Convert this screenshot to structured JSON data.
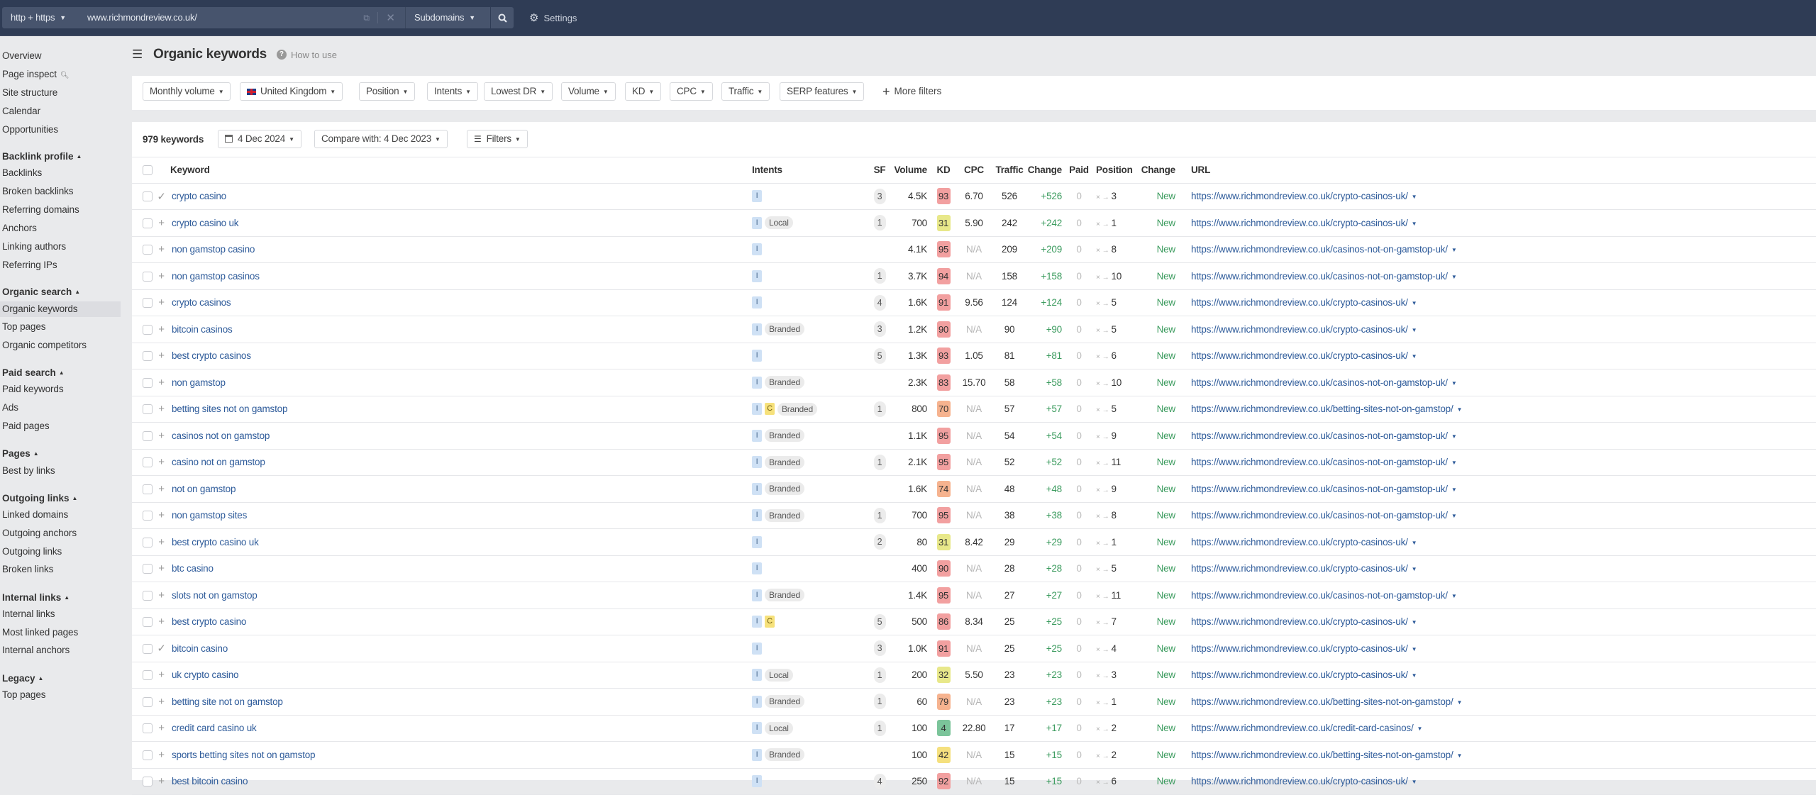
{
  "topbar": {
    "protocol": "http + https",
    "url": "www.richmondreview.co.uk/",
    "mode": "Subdomains",
    "settings": "Settings"
  },
  "sidebar": {
    "top_items": [
      "Overview",
      "Page inspect",
      "Site structure",
      "Calendar",
      "Opportunities"
    ],
    "sections": [
      {
        "title": "Backlink profile",
        "items": [
          "Backlinks",
          "Broken backlinks",
          "Referring domains",
          "Anchors",
          "Linking authors",
          "Referring IPs"
        ]
      },
      {
        "title": "Organic search",
        "items": [
          "Organic keywords",
          "Top pages",
          "Organic competitors"
        ]
      },
      {
        "title": "Paid search",
        "items": [
          "Paid keywords",
          "Ads",
          "Paid pages"
        ]
      },
      {
        "title": "Pages",
        "items": [
          "Best by links"
        ]
      },
      {
        "title": "Outgoing links",
        "items": [
          "Linked domains",
          "Outgoing anchors",
          "Outgoing links",
          "Broken links"
        ]
      },
      {
        "title": "Internal links",
        "items": [
          "Internal links",
          "Most linked pages",
          "Internal anchors"
        ]
      },
      {
        "title": "Legacy",
        "items": [
          "Top pages"
        ]
      }
    ],
    "active_item": "Organic keywords"
  },
  "header": {
    "title": "Organic keywords",
    "how_to_use": "How to use"
  },
  "filters": {
    "buttons": [
      "Monthly volume",
      "United Kingdom",
      "Position",
      "Intents",
      "Lowest DR",
      "Volume",
      "KD",
      "CPC",
      "Traffic",
      "SERP features"
    ],
    "more_filters": "More filters"
  },
  "toolbar": {
    "keyword_count": "979 keywords",
    "date": "4 Dec 2024",
    "compare": "Compare with: 4 Dec 2023",
    "filters": "Filters"
  },
  "table": {
    "columns": {
      "keyword": "Keyword",
      "intents": "Intents",
      "sf": "SF",
      "volume": "Volume",
      "kd": "KD",
      "cpc": "CPC",
      "traffic": "Traffic",
      "change": "Change",
      "paid": "Paid",
      "position": "Position",
      "position_change": "Change",
      "url": "URL"
    },
    "kd_colors": {
      "very_hard": "#f2a0a0",
      "hard": "#f6b38f",
      "medium": "#f5e07e",
      "easy_mid": "#e8e88a",
      "easy": "#7bc49a"
    },
    "rows": [
      {
        "action": "check",
        "keyword": "crypto casino",
        "intents": [
          "I"
        ],
        "tags": [],
        "sf": "3",
        "volume": "4.5K",
        "kd": 93,
        "cpc": "6.70",
        "traffic": "526",
        "change": "+526",
        "paid": "0",
        "position": "3",
        "pos_change": "New",
        "url": "https://www.richmondreview.co.uk/crypto-casinos-uk/"
      },
      {
        "action": "plus",
        "keyword": "crypto casino uk",
        "intents": [
          "I"
        ],
        "tags": [
          "Local"
        ],
        "sf": "1",
        "volume": "700",
        "kd": 31,
        "cpc": "5.90",
        "traffic": "242",
        "change": "+242",
        "paid": "0",
        "position": "1",
        "pos_change": "New",
        "url": "https://www.richmondreview.co.uk/crypto-casinos-uk/"
      },
      {
        "action": "plus",
        "keyword": "non gamstop casino",
        "intents": [
          "I"
        ],
        "tags": [],
        "sf": "",
        "volume": "4.1K",
        "kd": 95,
        "cpc": "N/A",
        "traffic": "209",
        "change": "+209",
        "paid": "0",
        "position": "8",
        "pos_change": "New",
        "url": "https://www.richmondreview.co.uk/casinos-not-on-gamstop-uk/"
      },
      {
        "action": "plus",
        "keyword": "non gamstop casinos",
        "intents": [
          "I"
        ],
        "tags": [],
        "sf": "1",
        "volume": "3.7K",
        "kd": 94,
        "cpc": "N/A",
        "traffic": "158",
        "change": "+158",
        "paid": "0",
        "position": "10",
        "pos_change": "New",
        "url": "https://www.richmondreview.co.uk/casinos-not-on-gamstop-uk/"
      },
      {
        "action": "plus",
        "keyword": "crypto casinos",
        "intents": [
          "I"
        ],
        "tags": [],
        "sf": "4",
        "volume": "1.6K",
        "kd": 91,
        "cpc": "9.56",
        "traffic": "124",
        "change": "+124",
        "paid": "0",
        "position": "5",
        "pos_change": "New",
        "url": "https://www.richmondreview.co.uk/crypto-casinos-uk/"
      },
      {
        "action": "plus",
        "keyword": "bitcoin casinos",
        "intents": [
          "I"
        ],
        "tags": [
          "Branded"
        ],
        "sf": "3",
        "volume": "1.2K",
        "kd": 90,
        "cpc": "N/A",
        "traffic": "90",
        "change": "+90",
        "paid": "0",
        "position": "5",
        "pos_change": "New",
        "url": "https://www.richmondreview.co.uk/crypto-casinos-uk/"
      },
      {
        "action": "plus",
        "keyword": "best crypto casinos",
        "intents": [
          "I"
        ],
        "tags": [],
        "sf": "5",
        "volume": "1.3K",
        "kd": 93,
        "cpc": "1.05",
        "traffic": "81",
        "change": "+81",
        "paid": "0",
        "position": "6",
        "pos_change": "New",
        "url": "https://www.richmondreview.co.uk/crypto-casinos-uk/"
      },
      {
        "action": "plus",
        "keyword": "non gamstop",
        "intents": [
          "I"
        ],
        "tags": [
          "Branded"
        ],
        "sf": "",
        "volume": "2.3K",
        "kd": 83,
        "cpc": "15.70",
        "traffic": "58",
        "change": "+58",
        "paid": "0",
        "position": "10",
        "pos_change": "New",
        "url": "https://www.richmondreview.co.uk/casinos-not-on-gamstop-uk/"
      },
      {
        "action": "plus",
        "keyword": "betting sites not on gamstop",
        "intents": [
          "I",
          "C"
        ],
        "tags": [
          "Branded"
        ],
        "sf": "1",
        "volume": "800",
        "kd": 70,
        "cpc": "N/A",
        "traffic": "57",
        "change": "+57",
        "paid": "0",
        "position": "5",
        "pos_change": "New",
        "url": "https://www.richmondreview.co.uk/betting-sites-not-on-gamstop/"
      },
      {
        "action": "plus",
        "keyword": "casinos not on gamstop",
        "intents": [
          "I"
        ],
        "tags": [
          "Branded"
        ],
        "sf": "",
        "volume": "1.1K",
        "kd": 95,
        "cpc": "N/A",
        "traffic": "54",
        "change": "+54",
        "paid": "0",
        "position": "9",
        "pos_change": "New",
        "url": "https://www.richmondreview.co.uk/casinos-not-on-gamstop-uk/"
      },
      {
        "action": "plus",
        "keyword": "casino not on gamstop",
        "intents": [
          "I"
        ],
        "tags": [
          "Branded"
        ],
        "sf": "1",
        "volume": "2.1K",
        "kd": 95,
        "cpc": "N/A",
        "traffic": "52",
        "change": "+52",
        "paid": "0",
        "position": "11",
        "pos_change": "New",
        "url": "https://www.richmondreview.co.uk/casinos-not-on-gamstop-uk/"
      },
      {
        "action": "plus",
        "keyword": "not on gamstop",
        "intents": [
          "I"
        ],
        "tags": [
          "Branded"
        ],
        "sf": "",
        "volume": "1.6K",
        "kd": 74,
        "cpc": "N/A",
        "traffic": "48",
        "change": "+48",
        "paid": "0",
        "position": "9",
        "pos_change": "New",
        "url": "https://www.richmondreview.co.uk/casinos-not-on-gamstop-uk/"
      },
      {
        "action": "plus",
        "keyword": "non gamstop sites",
        "intents": [
          "I"
        ],
        "tags": [
          "Branded"
        ],
        "sf": "1",
        "volume": "700",
        "kd": 95,
        "cpc": "N/A",
        "traffic": "38",
        "change": "+38",
        "paid": "0",
        "position": "8",
        "pos_change": "New",
        "url": "https://www.richmondreview.co.uk/casinos-not-on-gamstop-uk/"
      },
      {
        "action": "plus",
        "keyword": "best crypto casino uk",
        "intents": [
          "I"
        ],
        "tags": [],
        "sf": "2",
        "volume": "80",
        "kd": 31,
        "cpc": "8.42",
        "traffic": "29",
        "change": "+29",
        "paid": "0",
        "position": "1",
        "pos_change": "New",
        "url": "https://www.richmondreview.co.uk/crypto-casinos-uk/"
      },
      {
        "action": "plus",
        "keyword": "btc casino",
        "intents": [
          "I"
        ],
        "tags": [],
        "sf": "",
        "volume": "400",
        "kd": 90,
        "cpc": "N/A",
        "traffic": "28",
        "change": "+28",
        "paid": "0",
        "position": "5",
        "pos_change": "New",
        "url": "https://www.richmondreview.co.uk/crypto-casinos-uk/"
      },
      {
        "action": "plus",
        "keyword": "slots not on gamstop",
        "intents": [
          "I"
        ],
        "tags": [
          "Branded"
        ],
        "sf": "",
        "volume": "1.4K",
        "kd": 95,
        "cpc": "N/A",
        "traffic": "27",
        "change": "+27",
        "paid": "0",
        "position": "11",
        "pos_change": "New",
        "url": "https://www.richmondreview.co.uk/casinos-not-on-gamstop-uk/"
      },
      {
        "action": "plus",
        "keyword": "best crypto casino",
        "intents": [
          "I",
          "C"
        ],
        "tags": [],
        "sf": "5",
        "volume": "500",
        "kd": 86,
        "cpc": "8.34",
        "traffic": "25",
        "change": "+25",
        "paid": "0",
        "position": "7",
        "pos_change": "New",
        "url": "https://www.richmondreview.co.uk/crypto-casinos-uk/"
      },
      {
        "action": "check",
        "keyword": "bitcoin casino",
        "intents": [
          "I"
        ],
        "tags": [],
        "sf": "3",
        "volume": "1.0K",
        "kd": 91,
        "cpc": "N/A",
        "traffic": "25",
        "change": "+25",
        "paid": "0",
        "position": "4",
        "pos_change": "New",
        "url": "https://www.richmondreview.co.uk/crypto-casinos-uk/"
      },
      {
        "action": "plus",
        "keyword": "uk crypto casino",
        "intents": [
          "I"
        ],
        "tags": [
          "Local"
        ],
        "sf": "1",
        "volume": "200",
        "kd": 32,
        "cpc": "5.50",
        "traffic": "23",
        "change": "+23",
        "paid": "0",
        "position": "3",
        "pos_change": "New",
        "url": "https://www.richmondreview.co.uk/crypto-casinos-uk/"
      },
      {
        "action": "plus",
        "keyword": "betting site not on gamstop",
        "intents": [
          "I"
        ],
        "tags": [
          "Branded"
        ],
        "sf": "1",
        "volume": "60",
        "kd": 79,
        "cpc": "N/A",
        "traffic": "23",
        "change": "+23",
        "paid": "0",
        "position": "1",
        "pos_change": "New",
        "url": "https://www.richmondreview.co.uk/betting-sites-not-on-gamstop/"
      },
      {
        "action": "plus",
        "keyword": "credit card casino uk",
        "intents": [
          "I"
        ],
        "tags": [
          "Local"
        ],
        "sf": "1",
        "volume": "100",
        "kd": 4,
        "cpc": "22.80",
        "traffic": "17",
        "change": "+17",
        "paid": "0",
        "position": "2",
        "pos_change": "New",
        "url": "https://www.richmondreview.co.uk/credit-card-casinos/"
      },
      {
        "action": "plus",
        "keyword": "sports betting sites not on gamstop",
        "intents": [
          "I"
        ],
        "tags": [
          "Branded"
        ],
        "sf": "",
        "volume": "100",
        "kd": 42,
        "cpc": "N/A",
        "traffic": "15",
        "change": "+15",
        "paid": "0",
        "position": "2",
        "pos_change": "New",
        "url": "https://www.richmondreview.co.uk/betting-sites-not-on-gamstop/"
      },
      {
        "action": "plus",
        "keyword": "best bitcoin casino",
        "intents": [
          "I"
        ],
        "tags": [],
        "sf": "4",
        "volume": "250",
        "kd": 92,
        "cpc": "N/A",
        "traffic": "15",
        "change": "+15",
        "paid": "0",
        "position": "6",
        "pos_change": "New",
        "url": "https://www.richmondreview.co.uk/crypto-casinos-uk/"
      }
    ]
  }
}
